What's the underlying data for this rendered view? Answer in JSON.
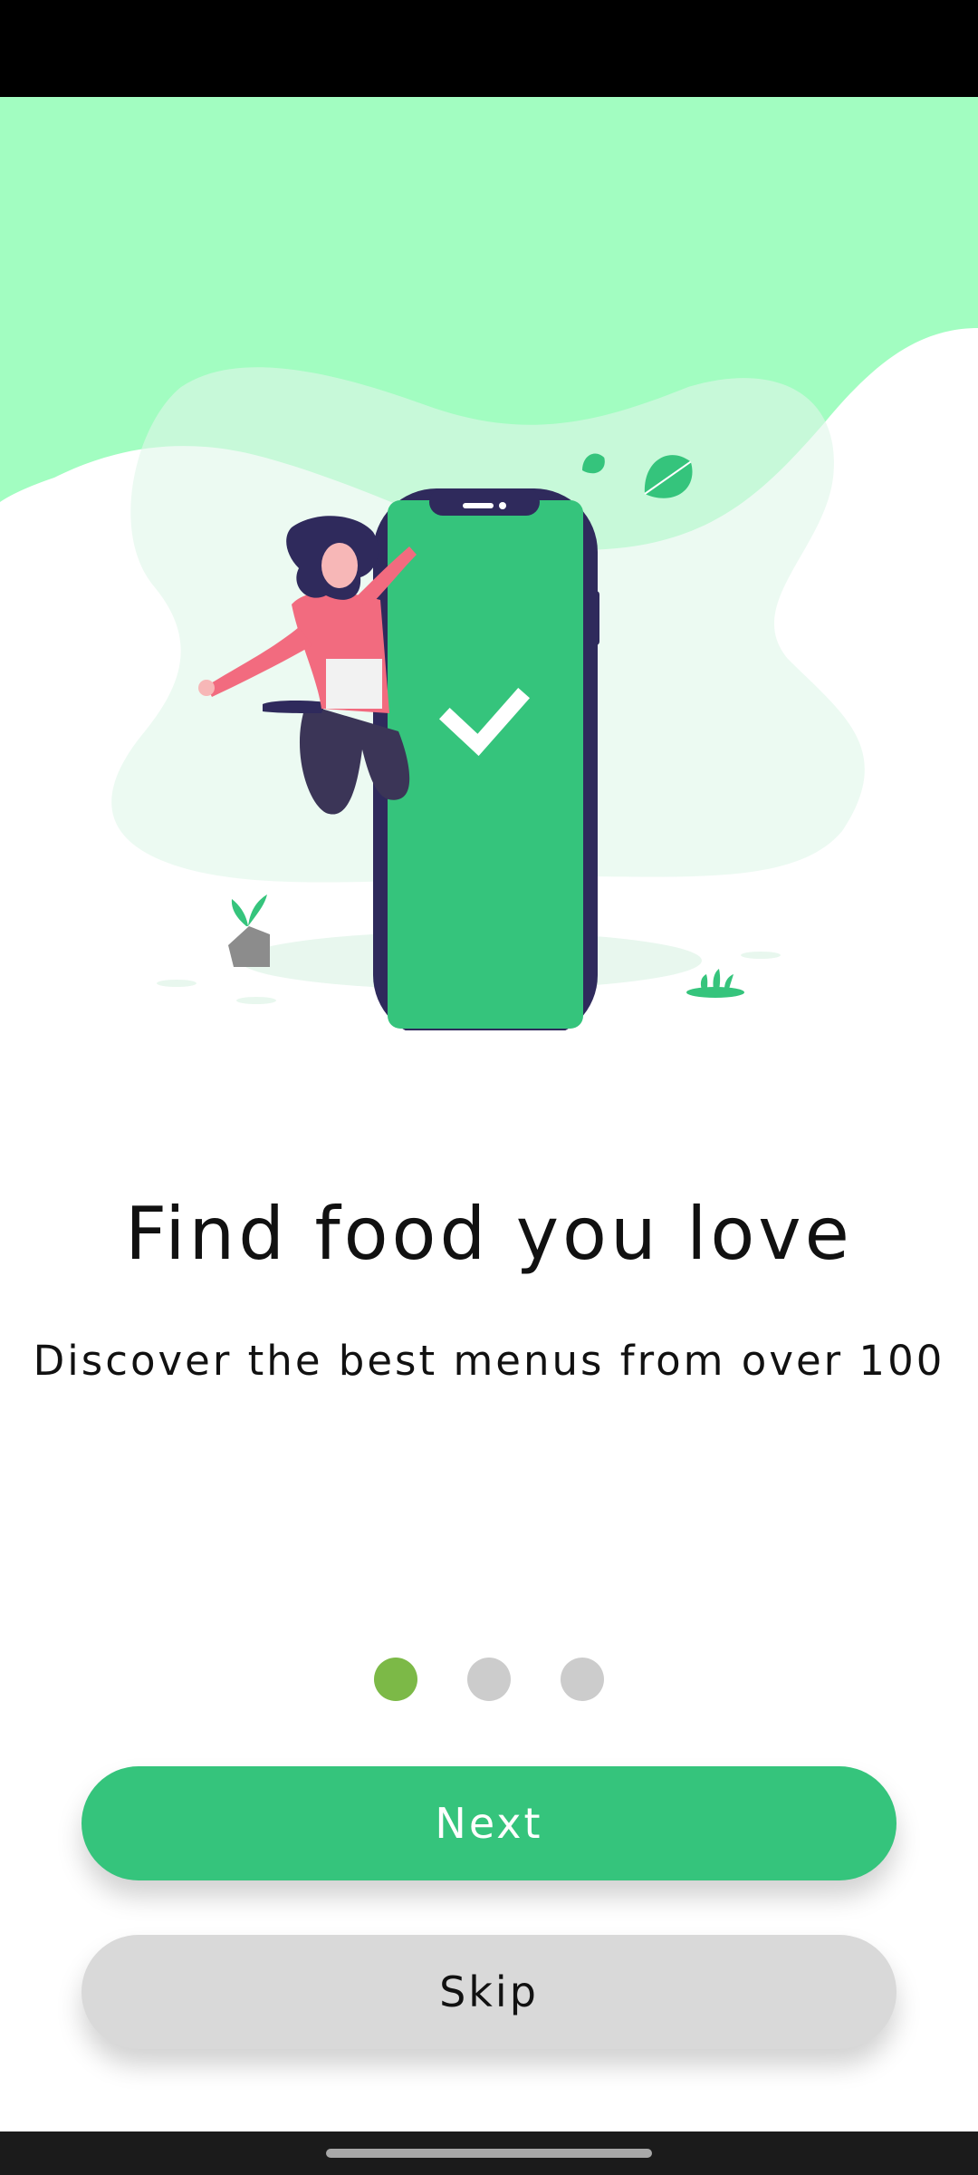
{
  "onboarding": {
    "title": "Find food you love",
    "subtitle": "Discover the best menus from over 100",
    "pager": {
      "total": 3,
      "active_index": 0
    },
    "next_label": "Next",
    "skip_label": "Skip"
  },
  "colors": {
    "primary": "#35c47c",
    "dot_active": "#7cb947",
    "dot_inactive": "#cccccc",
    "hero_background": "#a2fdc1",
    "skip_button": "#d9d9d9"
  }
}
